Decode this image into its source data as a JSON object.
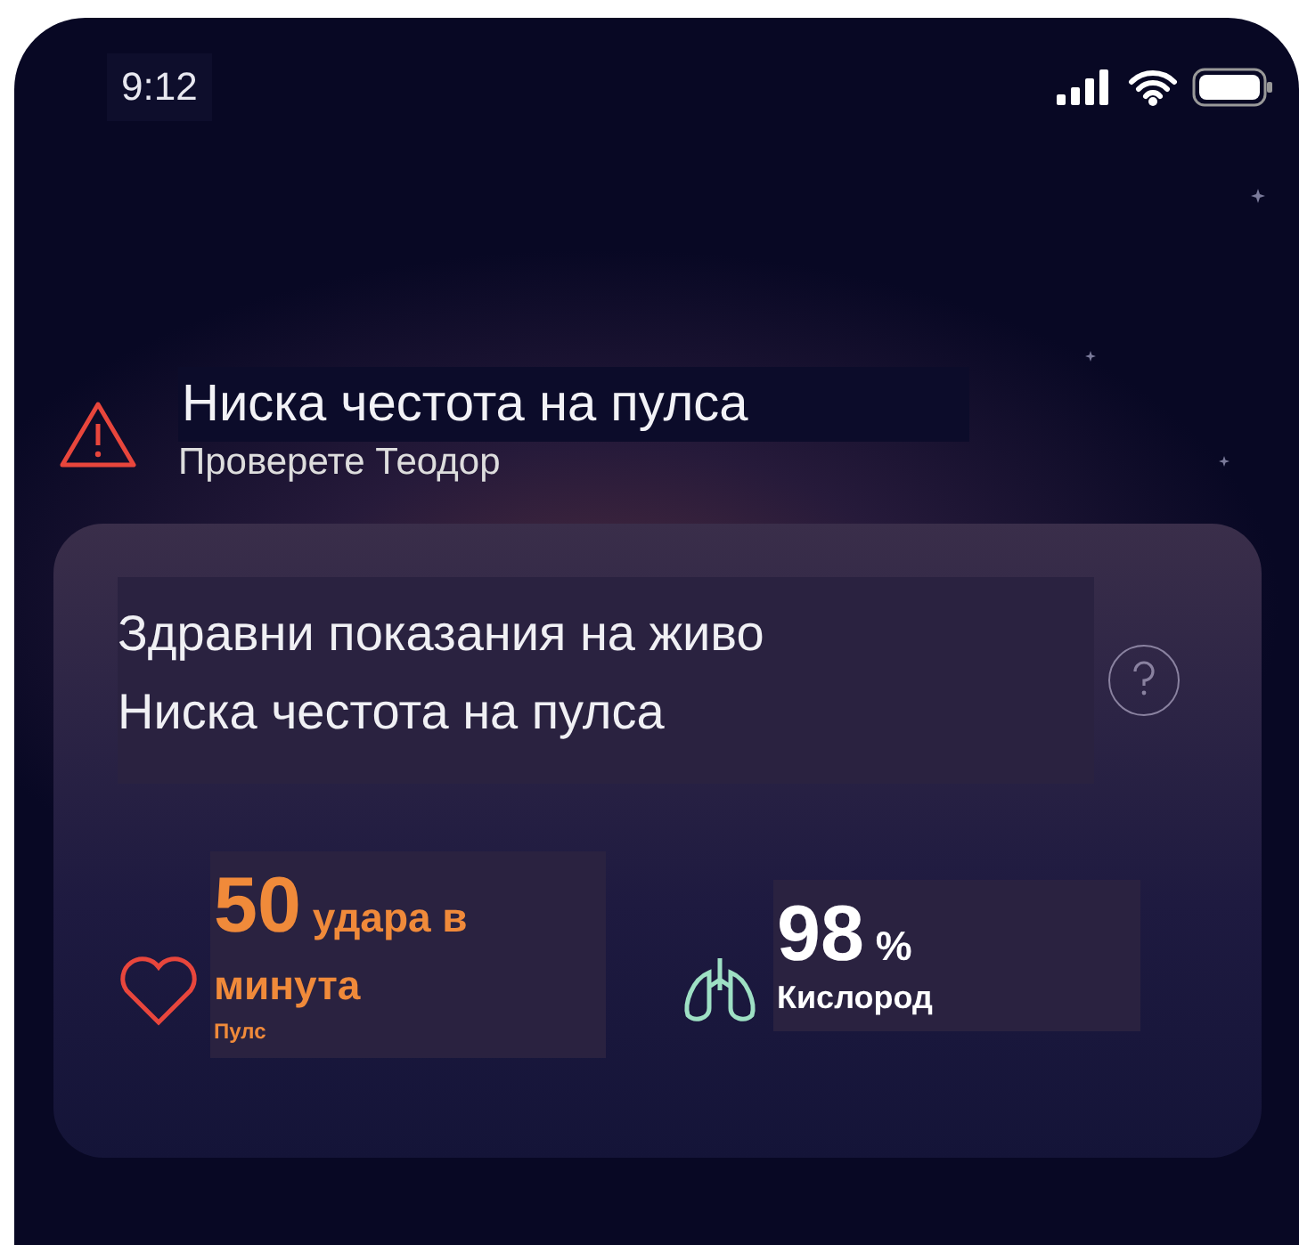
{
  "status_bar": {
    "time": "9:12"
  },
  "alert": {
    "title": "Ниска честота на пулса",
    "subtitle": "Проверете Теодор"
  },
  "card": {
    "title": "Здравни показания на живо",
    "subtitle": "Ниска честота на пулса",
    "metrics": [
      {
        "kind": "pulse",
        "value": "50",
        "unit": "удара в минута",
        "label": "Пулс"
      },
      {
        "kind": "oxygen",
        "value": "98",
        "unit": "%",
        "label": "Кислород"
      }
    ]
  }
}
